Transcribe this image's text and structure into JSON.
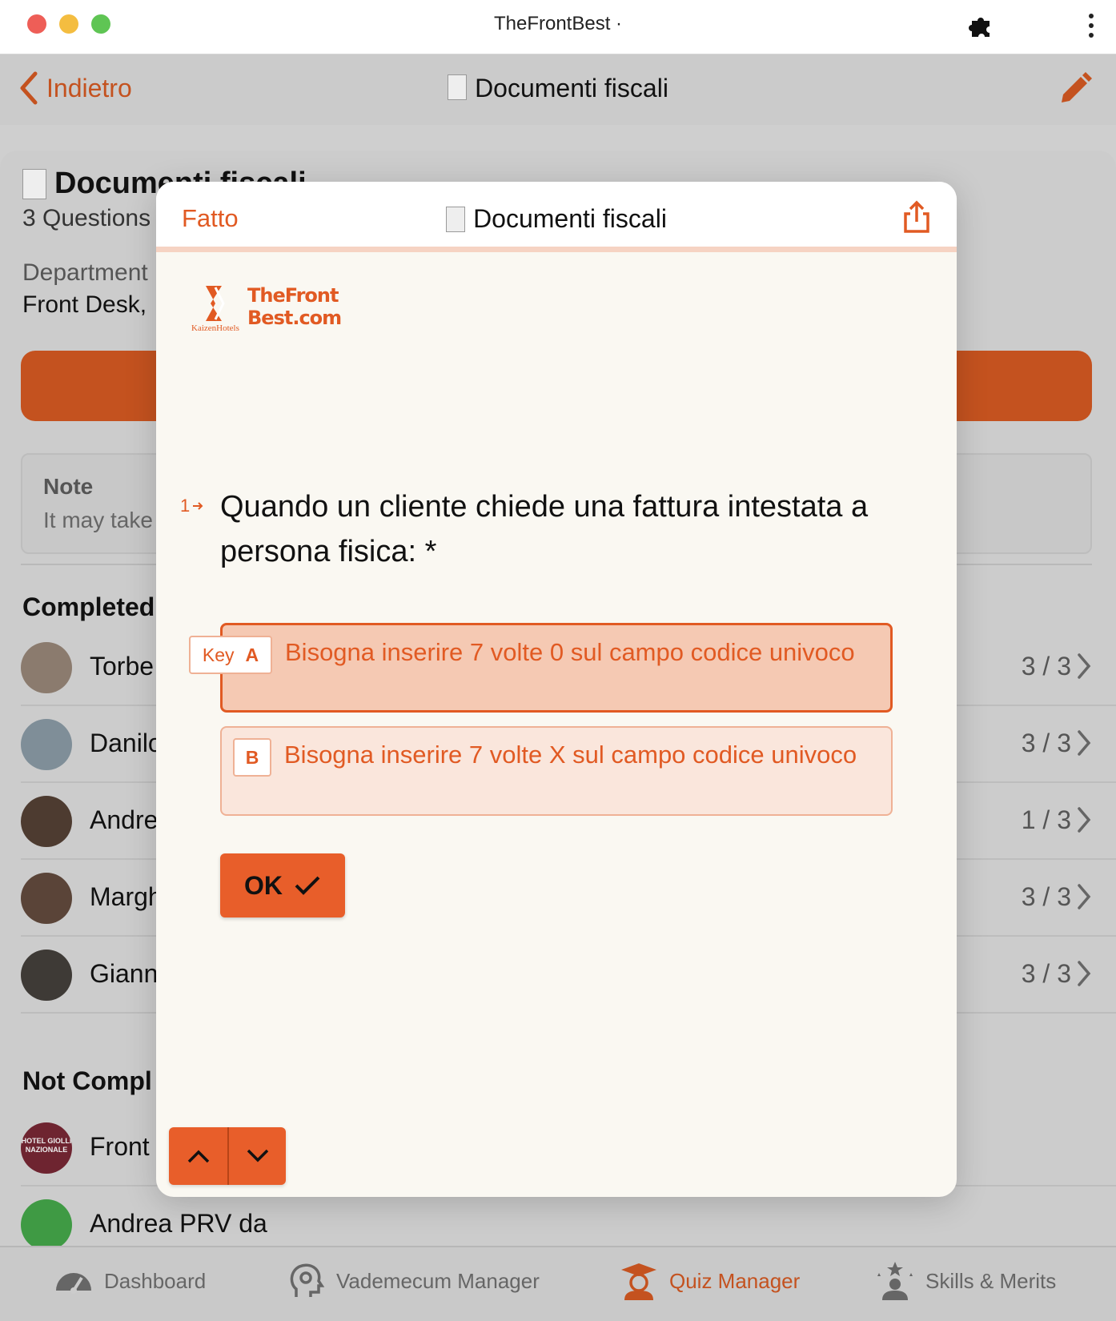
{
  "window": {
    "title": "TheFrontBest ·"
  },
  "navbar": {
    "back_label": "Indietro",
    "title": "Documenti fiscali"
  },
  "background": {
    "heading": "Documenti fiscali",
    "questions": "3 Questions",
    "department_label": "Department",
    "department_value": "Front Desk,",
    "note_title": "Note",
    "note_text": "It may take",
    "completed_title": "Completed",
    "completed_rows": [
      {
        "name": "Torbe",
        "score": "3 / 3"
      },
      {
        "name": "Danilo",
        "score": "3 / 3"
      },
      {
        "name": "Andre",
        "score": "1 / 3"
      },
      {
        "name": "Margh",
        "score": "3 / 3"
      },
      {
        "name": "Giann",
        "score": "3 / 3"
      }
    ],
    "not_completed_title": "Not Compl",
    "not_completed_rows": [
      {
        "name": "Front",
        "avatar_text": "HOTEL GIOLLI NAZIONALE"
      },
      {
        "name": "Andrea PRV da"
      }
    ]
  },
  "tabs": [
    {
      "label": "Dashboard",
      "icon": "gauge-icon",
      "active": false
    },
    {
      "label": "Vademecum Manager",
      "icon": "brain-gear-icon",
      "active": false
    },
    {
      "label": "Quiz Manager",
      "icon": "graduate-icon",
      "active": true
    },
    {
      "label": "Skills & Merits",
      "icon": "stars-person-icon",
      "active": false
    }
  ],
  "modal": {
    "done_label": "Fatto",
    "title": "Documenti fiscali",
    "logo": {
      "line1": "TheFront",
      "line2": "Best.com",
      "sub": "KaizenHotels"
    },
    "question": {
      "number": "1",
      "text": "Quando un cliente chiede una fattura intestata a persona fisica: *"
    },
    "key_hint": "Key",
    "options": [
      {
        "key": "A",
        "text": "Bisogna inserire 7 volte 0 sul campo codice univoco",
        "selected": true
      },
      {
        "key": "B",
        "text": "Bisogna inserire 7 volte X sul campo codice univoco",
        "selected": false
      }
    ],
    "ok_label": "OK"
  },
  "colors": {
    "accent": "#e15a23",
    "accent_dim": "#c4521f",
    "modal_bg": "#faf8f2"
  }
}
